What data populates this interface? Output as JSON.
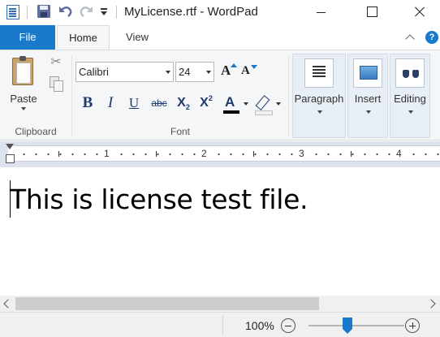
{
  "window": {
    "title": "MyLicense.rtf - WordPad"
  },
  "quick_access": {
    "icons": [
      "wordpad-icon",
      "save-icon",
      "undo-icon",
      "redo-icon",
      "customize-dropdown-icon"
    ]
  },
  "tabs": {
    "file": "File",
    "home": "Home",
    "view": "View"
  },
  "ribbon": {
    "clipboard": {
      "paste_label": "Paste",
      "group_label": "Clipboard"
    },
    "font": {
      "font_name": "Calibri",
      "font_size": "24",
      "group_label": "Font",
      "buttons": {
        "bold": "B",
        "italic": "I",
        "underline": "U",
        "strikethrough": "abc",
        "subscript": "X",
        "subscript_mark": "2",
        "superscript": "X",
        "superscript_mark": "2",
        "text_color": "A"
      }
    },
    "paragraph": {
      "label": "Paragraph"
    },
    "insert": {
      "label": "Insert"
    },
    "editing": {
      "label": "Editing"
    }
  },
  "ruler": {
    "marks": [
      "1",
      "2",
      "3",
      "4"
    ]
  },
  "document": {
    "text": "This is license test file."
  },
  "status": {
    "zoom": "100%",
    "zoom_fraction": 0.4
  },
  "colors": {
    "accent": "#1979ca",
    "ribbon_bg": "#f5f6f7",
    "text_color_swatch": "#000000"
  }
}
